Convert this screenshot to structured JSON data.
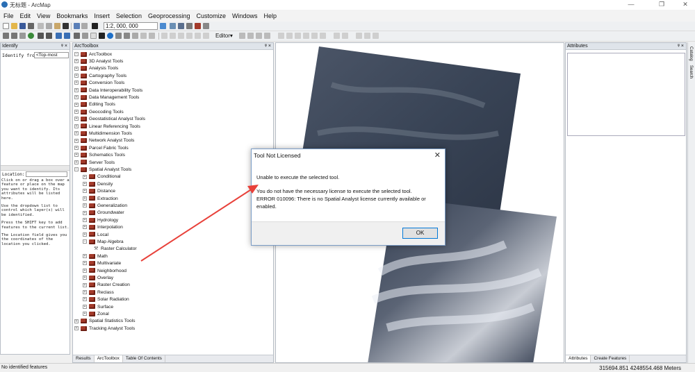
{
  "window": {
    "title": "无标题 - ArcMap",
    "minimize": "—",
    "maximize": "❐",
    "close": "✕"
  },
  "menu": [
    "File",
    "Edit",
    "View",
    "Bookmarks",
    "Insert",
    "Selection",
    "Geoprocessing",
    "Customize",
    "Windows",
    "Help"
  ],
  "toolbar": {
    "scale": "1:2, 000, 000",
    "editor": "Editor▾"
  },
  "identify": {
    "title": "Identify",
    "identify_from_label": "Identify from:",
    "identify_from_value": "<Top-most",
    "location_label": "Location:",
    "help": [
      "Click on or drag a box over a feature or place on the map you want to identify. Its attributes will be listed here.",
      "Use the dropdown list to control which layer(s) will be identified.",
      "Press the SHIFT key to add features to the current list.",
      "The Location field gives you the coordinates of the location you clicked."
    ]
  },
  "toolbox": {
    "title": "ArcToolbox",
    "root": "ArcToolbox",
    "items": [
      {
        "label": "3D Analyst Tools",
        "level": 1,
        "exp": "+"
      },
      {
        "label": "Analysis Tools",
        "level": 1,
        "exp": "+"
      },
      {
        "label": "Cartography Tools",
        "level": 1,
        "exp": "+"
      },
      {
        "label": "Conversion Tools",
        "level": 1,
        "exp": "+"
      },
      {
        "label": "Data Interoperability Tools",
        "level": 1,
        "exp": "+"
      },
      {
        "label": "Data Management Tools",
        "level": 1,
        "exp": "+"
      },
      {
        "label": "Editing Tools",
        "level": 1,
        "exp": "+"
      },
      {
        "label": "Geocoding Tools",
        "level": 1,
        "exp": "+"
      },
      {
        "label": "Geostatistical Analyst Tools",
        "level": 1,
        "exp": "+"
      },
      {
        "label": "Linear Referencing Tools",
        "level": 1,
        "exp": "+"
      },
      {
        "label": "Multidimension Tools",
        "level": 1,
        "exp": "+"
      },
      {
        "label": "Network Analyst Tools",
        "level": 1,
        "exp": "+"
      },
      {
        "label": "Parcel Fabric Tools",
        "level": 1,
        "exp": "+"
      },
      {
        "label": "Schematics Tools",
        "level": 1,
        "exp": "+"
      },
      {
        "label": "Server Tools",
        "level": 1,
        "exp": "+"
      },
      {
        "label": "Spatial Analyst Tools",
        "level": 1,
        "exp": "−"
      },
      {
        "label": "Conditional",
        "level": 2,
        "exp": "+"
      },
      {
        "label": "Density",
        "level": 2,
        "exp": "+"
      },
      {
        "label": "Distance",
        "level": 2,
        "exp": "+"
      },
      {
        "label": "Extraction",
        "level": 2,
        "exp": "+"
      },
      {
        "label": "Generalization",
        "level": 2,
        "exp": "+"
      },
      {
        "label": "Groundwater",
        "level": 2,
        "exp": "+"
      },
      {
        "label": "Hydrology",
        "level": 2,
        "exp": "+"
      },
      {
        "label": "Interpolation",
        "level": 2,
        "exp": "+"
      },
      {
        "label": "Local",
        "level": 2,
        "exp": "+"
      },
      {
        "label": "Map Algebra",
        "level": 2,
        "exp": "−"
      },
      {
        "label": "Raster Calculator",
        "level": 3,
        "exp": ""
      },
      {
        "label": "Math",
        "level": 2,
        "exp": "+"
      },
      {
        "label": "Multivariate",
        "level": 2,
        "exp": "+"
      },
      {
        "label": "Neighborhood",
        "level": 2,
        "exp": "+"
      },
      {
        "label": "Overlay",
        "level": 2,
        "exp": "+"
      },
      {
        "label": "Raster Creation",
        "level": 2,
        "exp": "+"
      },
      {
        "label": "Reclass",
        "level": 2,
        "exp": "+"
      },
      {
        "label": "Solar Radiation",
        "level": 2,
        "exp": "+"
      },
      {
        "label": "Surface",
        "level": 2,
        "exp": "+"
      },
      {
        "label": "Zonal",
        "level": 2,
        "exp": "+"
      },
      {
        "label": "Spatial Statistics Tools",
        "level": 1,
        "exp": "+"
      },
      {
        "label": "Tracking Analyst Tools",
        "level": 1,
        "exp": "+"
      }
    ],
    "tabs": [
      "Results",
      "ArcToolbox",
      "Table Of Contents"
    ]
  },
  "attributes": {
    "title": "Attributes",
    "tabs": [
      "Attributes",
      "Create Features"
    ],
    "side_tabs": [
      "Catalog",
      "Search"
    ]
  },
  "dialog": {
    "title": "Tool Not Licensed",
    "line1": "Unable to execute the selected tool.",
    "line2": "You do not have the necessary license to execute the selected tool.",
    "line3": "ERROR 010096: There is no Spatial Analyst license currently available or enabled.",
    "ok": "OK"
  },
  "status": {
    "left": "No identified features",
    "coords": "315694.851  4248554.468 Meters"
  },
  "watermark": {
    "brand": "Bai",
    "brand2": "du",
    "cn": "经验",
    "url": "jingyan.baidu.com"
  },
  "colors": {
    "accent": "#0078d7",
    "arrow": "#e8413a",
    "toolbox_icon": "#a33a2a"
  }
}
